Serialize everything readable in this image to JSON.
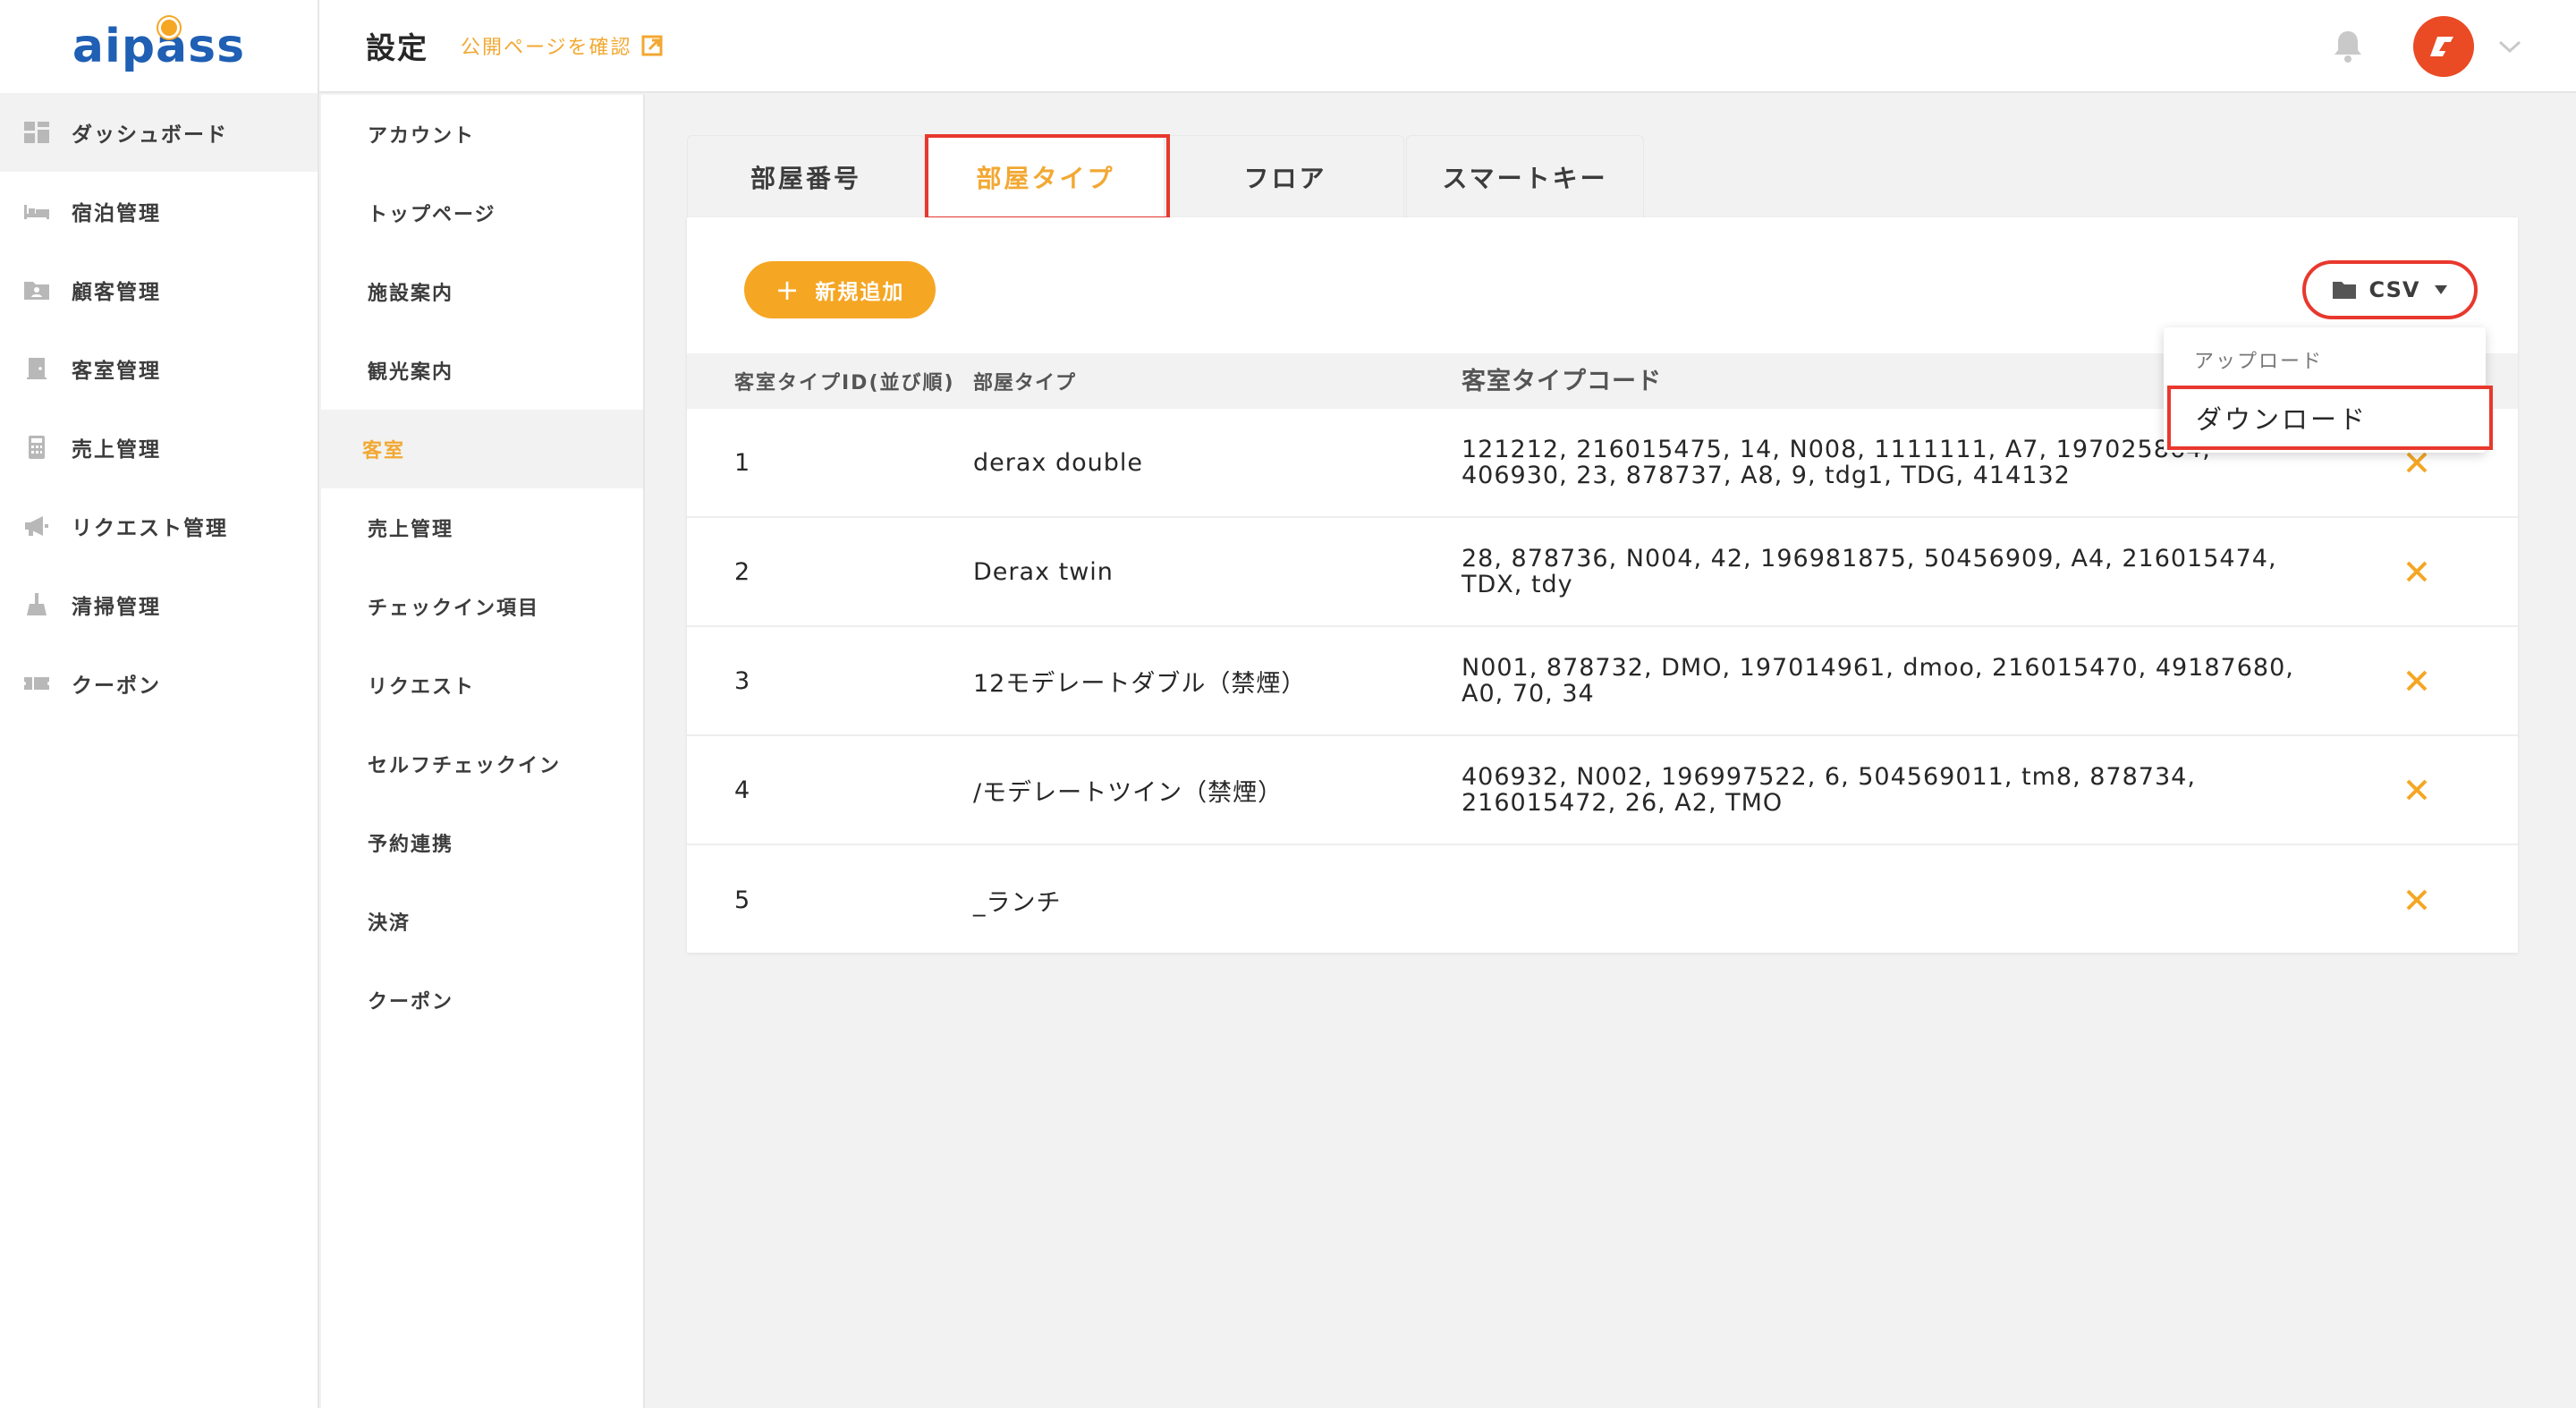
{
  "app": {
    "logo_text": "aipass"
  },
  "sidebar": {
    "items": [
      {
        "label": "ダッシュボード",
        "icon": "dashboard-icon",
        "active": true
      },
      {
        "label": "宿泊管理",
        "icon": "bed-icon"
      },
      {
        "label": "顧客管理",
        "icon": "customer-folder-icon"
      },
      {
        "label": "客室管理",
        "icon": "door-icon"
      },
      {
        "label": "売上管理",
        "icon": "calculator-icon"
      },
      {
        "label": "リクエスト管理",
        "icon": "megaphone-icon"
      },
      {
        "label": "清掃管理",
        "icon": "broom-icon"
      },
      {
        "label": "クーポン",
        "icon": "coupon-icon"
      }
    ]
  },
  "header": {
    "title": "設定",
    "public_link": "公開ページを確認",
    "colors": {
      "accent": "#f2a832",
      "avatar": "#ea4a24"
    }
  },
  "subnav": {
    "items": [
      "アカウント",
      "トップページ",
      "施設案内",
      "観光案内",
      "客室",
      "売上管理",
      "チェックイン項目",
      "リクエスト",
      "セルフチェックイン",
      "予約連携",
      "決済",
      "クーポン"
    ],
    "active_index": 4
  },
  "tabs": [
    {
      "label": "部屋番号"
    },
    {
      "label": "部屋タイプ",
      "active": true
    },
    {
      "label": "フロア"
    },
    {
      "label": "スマートキー"
    }
  ],
  "toolbar": {
    "add_label": "新規追加",
    "csv_label": "CSV"
  },
  "csv_menu": {
    "upload_label": "アップロード",
    "download_label": "ダウンロード"
  },
  "table": {
    "headers": [
      "客室タイプID(並び順)",
      "部屋タイプ",
      "客室タイプコード"
    ],
    "rows": [
      {
        "id": "1",
        "type": "derax double",
        "codes": "121212, 216015475, 14, N008, 1111111, A7, 197025864, 406930, 23, 878737, A8, 9, tdg1, TDG, 414132"
      },
      {
        "id": "2",
        "type": "Derax twin",
        "codes": "28, 878736, N004, 42, 196981875, 50456909, A4, 216015474, TDX, tdy"
      },
      {
        "id": "3",
        "type": "12モデレートダブル（禁煙）",
        "codes": "N001, 878732, DMO, 197014961, dmoo, 216015470, 49187680, A0, 70, 34"
      },
      {
        "id": "4",
        "type": "/モデレートツイン（禁煙）",
        "codes": "406932, N002, 196997522, 6, 504569011, tm8, 878734, 216015472, 26, A2, TMO"
      },
      {
        "id": "5",
        "type": "_ランチ",
        "codes": ""
      }
    ]
  }
}
